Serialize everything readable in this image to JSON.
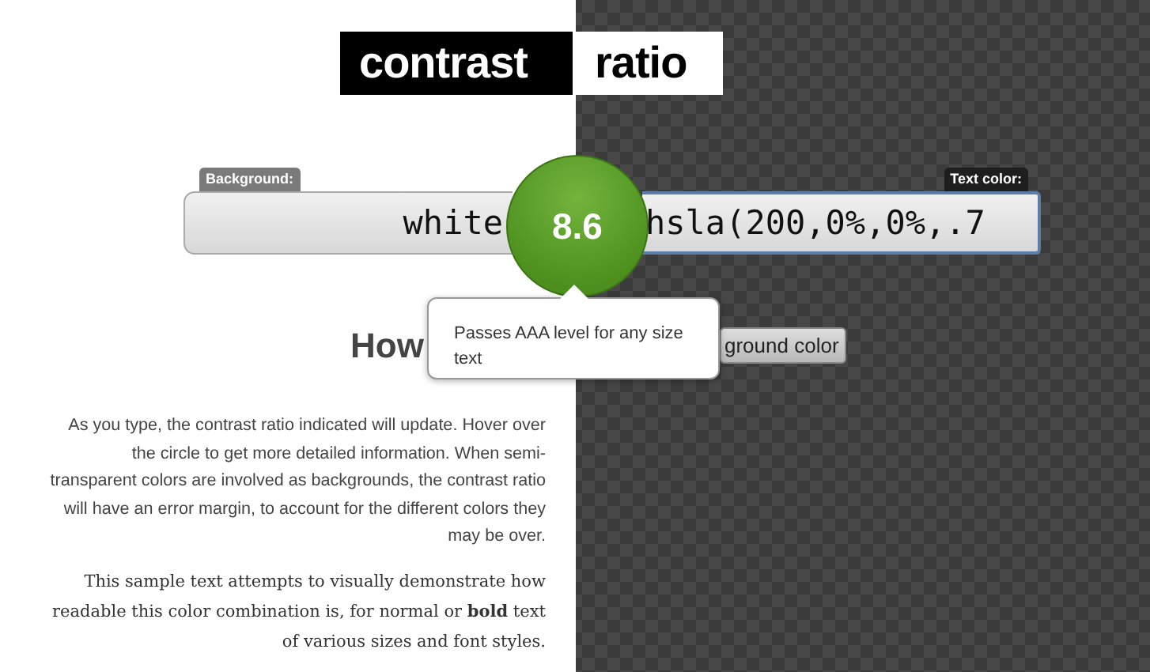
{
  "title": {
    "word_1": "contrast",
    "word_2": "ratio"
  },
  "background": {
    "label": "Background:",
    "value": "white"
  },
  "text_color": {
    "label": "Text color:",
    "value": "hsla(200,0%,0%,.7",
    "focused": true
  },
  "ratio": {
    "value": "8.6"
  },
  "tooltip": {
    "text": "Passes AAA level for any size text"
  },
  "heading": "How",
  "button": "ground color",
  "paragraphs": [
    {
      "kind": "info",
      "text": "As you type, the contrast ratio indicated will update. Hover over the circle to get more detailed information. When semi-transparent colors are involved as backgrounds, the contrast ratio will have an error margin, to account for the different colors they may be over."
    },
    {
      "kind": "sample",
      "text": "This sample text attempts to visually demonstrate how readable this color combination is, for normal or **bold** text of various sizes and font styles."
    }
  ]
}
